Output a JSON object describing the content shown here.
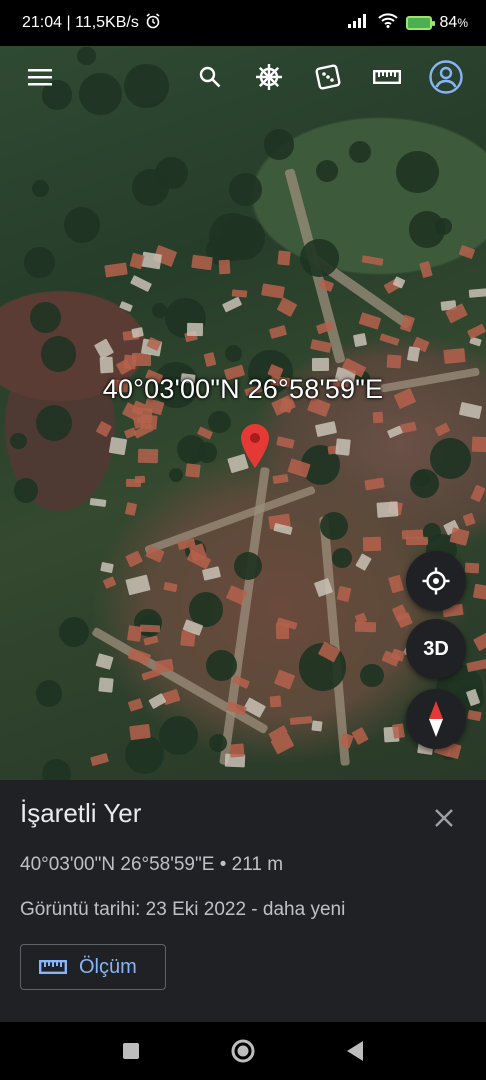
{
  "status_bar": {
    "time_speed": "21:04 | 11,5KB/s",
    "alarm_icon": "alarm-icon",
    "signal_icon": "signal-icon",
    "wifi_icon": "wifi-icon",
    "battery_percent": "84",
    "battery_unit": "%"
  },
  "toolbar": {
    "menu_icon": "hamburger-menu-icon",
    "search_icon": "search-icon",
    "voyager_icon": "ship-wheel-icon",
    "random_icon": "dice-icon",
    "measure_icon": "ruler-icon",
    "account_icon": "account-icon"
  },
  "map": {
    "coordinates_label": "40°03'00\"N 26°58'59\"E",
    "pin_color": "#e53935"
  },
  "map_controls": {
    "locate_icon": "my-location-icon",
    "three_d_label": "3D",
    "compass_icon": "compass-icon"
  },
  "sheet": {
    "title": "İşaretli Yer",
    "coordinates_elevation": "40°03'00\"N 26°58'59\"E • 211 m",
    "imagery_date": "Görüntü tarihi: 23 Eki 2022 - daha yeni",
    "measure_button_label": "Ölçüm",
    "close_icon": "close-icon"
  },
  "navbar": {
    "recents_icon": "square-icon",
    "home_icon": "circle-icon",
    "back_icon": "triangle-back-icon"
  },
  "colors": {
    "accent": "#8ab4f8",
    "sheet_bg": "#202124"
  }
}
